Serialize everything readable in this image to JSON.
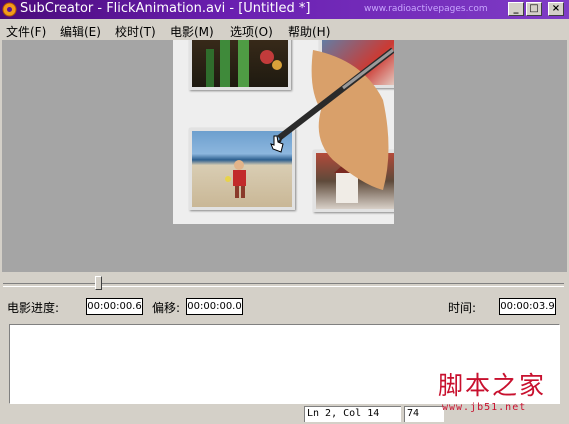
{
  "window": {
    "title": "SubCreator - FlickAnimation.avi - [Untitled *]",
    "url": "www.radioactivepages.com",
    "minimize": "_",
    "maximize": "□",
    "close": "×"
  },
  "menu": {
    "items": [
      {
        "label": "文件(F)"
      },
      {
        "label": "编辑(E)"
      },
      {
        "label": "校时(T)"
      },
      {
        "label": "电影(M)"
      },
      {
        "label": "选项(O)"
      },
      {
        "label": "帮助(H)"
      }
    ]
  },
  "playback": {
    "slider_position_fraction": 0.17
  },
  "info": {
    "progress_label": "电影进度:",
    "progress_value": "00:00:00.6",
    "offset_label": "偏移:",
    "offset_value": "00:00:00.0",
    "time_label": "时间:",
    "time_value": "00:00:03.9"
  },
  "editor": {
    "content": ""
  },
  "status": {
    "position": "Ln 2, Col 14",
    "extra": "74"
  },
  "watermark": {
    "main": "脚本之家",
    "sub": "www.jb51.net"
  },
  "colors": {
    "titlebar": "#5a1496",
    "video_bg": "#a5a5a5",
    "watermark": "#c8102e"
  }
}
